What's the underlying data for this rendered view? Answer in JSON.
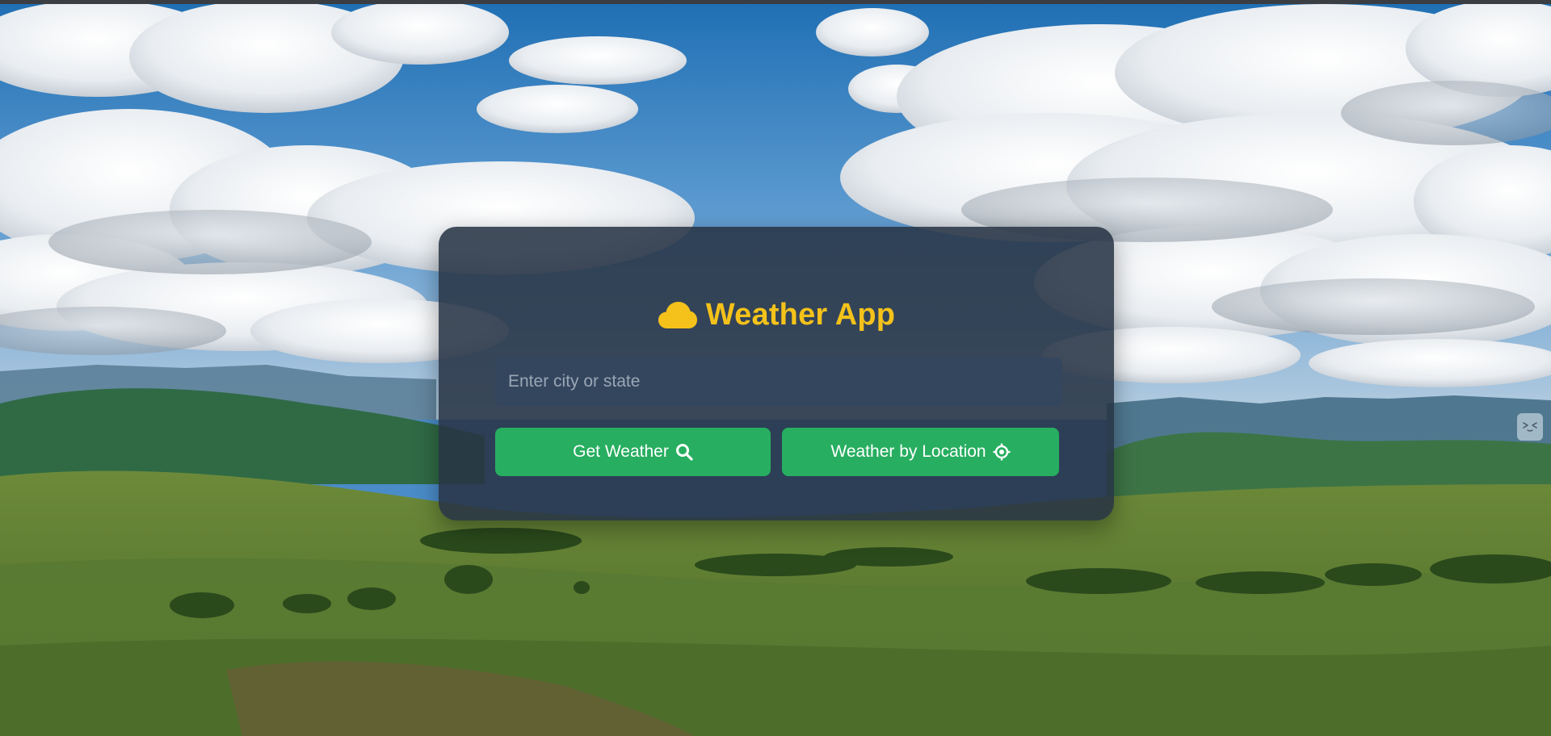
{
  "app": {
    "title": "Weather App",
    "icon": "cloud-icon",
    "accent_color": "#f4c21a"
  },
  "search": {
    "placeholder": "Enter city or state",
    "value": ""
  },
  "buttons": {
    "get_weather_label": "Get Weather",
    "get_weather_icon": "search-icon",
    "by_location_label": "Weather by Location",
    "by_location_icon": "crosshair-icon",
    "color": "#27ae60"
  },
  "side_widget": {
    "icon": "assistant-face-icon"
  }
}
